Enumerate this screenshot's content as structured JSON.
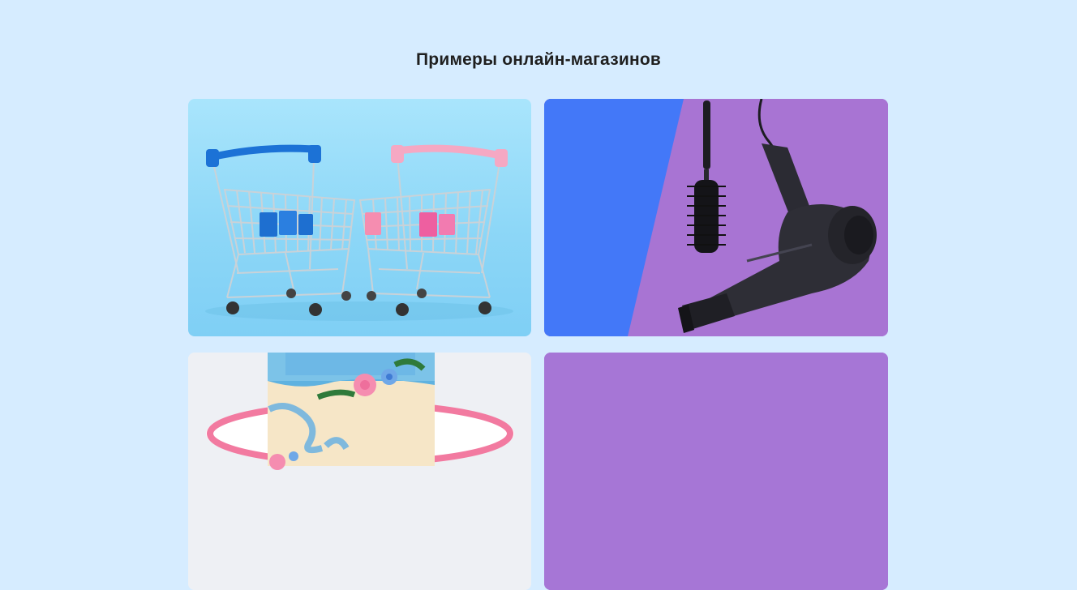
{
  "section": {
    "title": "Примеры онлайн-магазинов"
  },
  "cards": [
    {
      "image": "shopping-carts-image"
    },
    {
      "image": "hairdryer-brush-image"
    },
    {
      "image": "cake-image"
    },
    {
      "image": "purple-background-image"
    }
  ],
  "colors": {
    "background": "#d6ecff",
    "title": "#1f1f1f",
    "blue_accent": "#4378f8",
    "purple": "#a874d3"
  }
}
